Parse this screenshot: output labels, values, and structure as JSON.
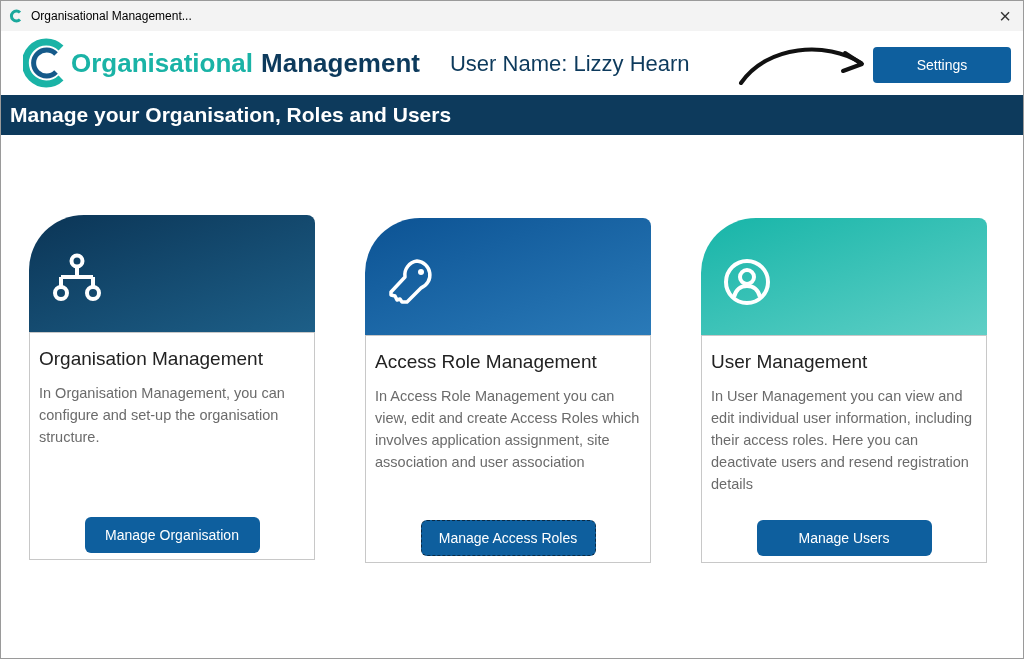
{
  "window": {
    "title": "Organisational Management...",
    "close": "×"
  },
  "header": {
    "logo": {
      "accent": "Organisational",
      "main": "Management"
    },
    "user_name": "User Name: Lizzy Hearn",
    "settings_button": "Settings"
  },
  "banner": {
    "title": "Manage your Organisation, Roles and Users"
  },
  "cards": [
    {
      "kind": "organisation",
      "title": "Organisation Management",
      "description": "In Organisation Management, you can configure and set-up the organisation structure.",
      "button": {
        "label": "Manage Organisation",
        "focused": false
      }
    },
    {
      "kind": "access",
      "title": "Access Role Management",
      "description": "In Access Role Management you can view, edit and create Access Roles which involves application assignment, site association and user association",
      "button": {
        "label": "Manage Access Roles",
        "focused": true
      }
    },
    {
      "kind": "user",
      "title": "User Management",
      "description": "In User Management you can view and edit  individual user information, including their access roles. Here you can deactivate users and resend registration details",
      "button": {
        "label": "Manage Users",
        "focused": false
      }
    }
  ]
}
